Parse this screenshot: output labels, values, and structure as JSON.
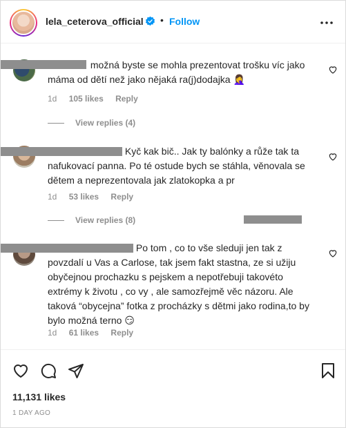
{
  "header": {
    "username": "lela_ceterova_official",
    "separator": "•",
    "follow_label": "Follow",
    "verified_icon": "verified-badge-icon",
    "more_icon": "more-options-icon"
  },
  "comments": [
    {
      "text_line1_after": "možná byste se mohla prezentovat trošku víc jako",
      "text_rest": "máma od dětí než jako nějaká ra(j)dodajka 🤦‍♀️",
      "age": "1d",
      "likes": "105 likes",
      "reply": "Reply",
      "view_replies": "View replies (4)"
    },
    {
      "text_line1_after": "Kyč kak bič.. Jak ty balónky a růže tak ta",
      "text_line2": "nafukovací panna. Po té ostude bych se stáhla, věnovala se",
      "text_line3": "dětem a neprezentovala jak zlatokopka a pr",
      "age": "1d",
      "likes": "53 likes",
      "reply": "Reply",
      "view_replies": "View replies (8)"
    },
    {
      "text_line1_after": "Po tom , co to vše sleduji jen tak z",
      "text_rest": "povzdalí u Vas a Carlose, tak jsem fakt stastna, ze si užiju obyčejnou prochazku s pejskem a nepotřebuji takovéto extrémy k životu , co vy , ale samozřejmě věc názoru. Ale taková “obycejna” fotka z procházky s dětmi jako rodina,to by bylo možná terno 😏",
      "age": "1d",
      "likes": "61 likes",
      "reply": "Reply"
    }
  ],
  "footer": {
    "likes": "11,131 likes",
    "time_ago": "1 DAY AGO"
  },
  "colors": {
    "accent": "#0095f6",
    "text": "#262626",
    "muted": "#8e8e8e"
  }
}
